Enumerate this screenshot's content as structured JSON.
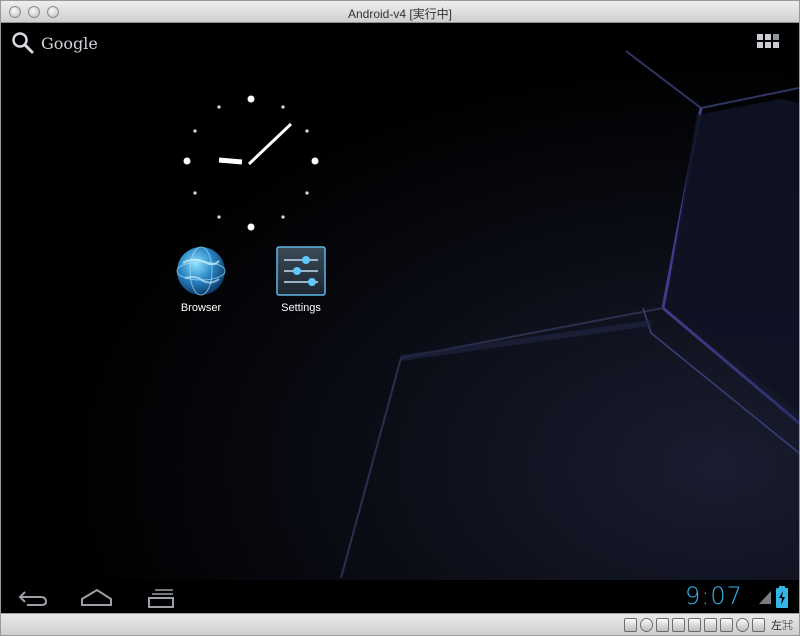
{
  "window": {
    "title": "Android-v4 [実行中]"
  },
  "search": {
    "label": "Google",
    "icon": "search-icon"
  },
  "launcher": {
    "apps_button_icon": "all-apps-grid-icon"
  },
  "clock": {
    "type": "analog",
    "hour_icon": "analog-clock"
  },
  "apps": [
    {
      "label": "Browser",
      "icon": "globe-icon"
    },
    {
      "label": "Settings",
      "icon": "settings-sliders-icon"
    }
  ],
  "navbar": {
    "back_icon": "back-icon",
    "home_icon": "home-icon",
    "recents_icon": "recent-apps-icon",
    "time": "9:07",
    "accent": "#33b5e5"
  },
  "host_statusbar": {
    "icons": [
      "hard-disk-icon",
      "optical-disk-icon",
      "usb-icon",
      "shared-folder-icon",
      "network-icon",
      "display-icon",
      "video-capture-icon",
      "mouse-integration-icon",
      "cpu-icon"
    ],
    "host_key": "左⌘"
  }
}
